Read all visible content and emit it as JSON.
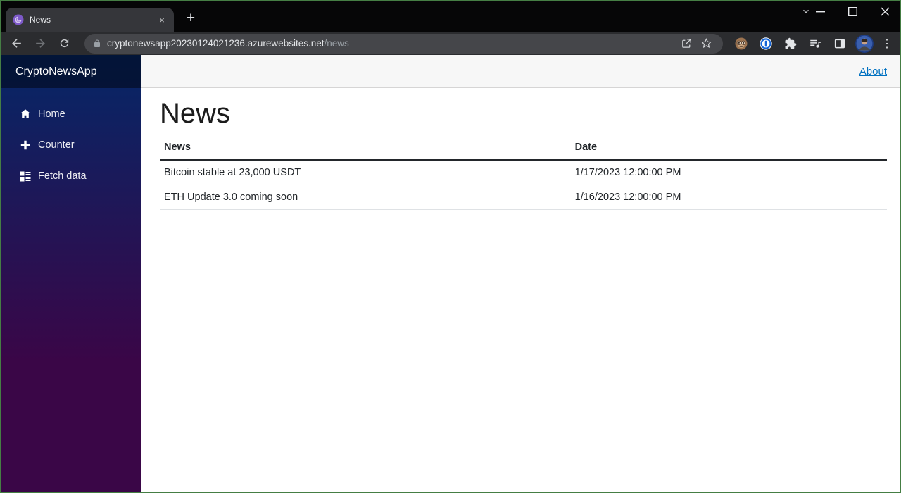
{
  "browser": {
    "tab_title": "News",
    "new_tab_glyph": "+",
    "tab_close_glyph": "×",
    "menu_dots_glyph": "⋮",
    "url": {
      "host": "cryptonewsapp20230124021236.azurewebsites.net",
      "path": "/news"
    },
    "toolbar_icons": [
      "back-icon",
      "forward-icon",
      "refresh-icon",
      "lock-icon",
      "share-icon",
      "bookmark-star-icon",
      "monkey-extension-icon",
      "onepassword-extension-icon",
      "puzzle-extensions-icon",
      "queue-music-extension-icon",
      "side-panel-icon",
      "profile-avatar",
      "kebab-menu-icon"
    ],
    "window_control_icons": [
      "chevron-down-icon",
      "minimize-icon",
      "maximize-icon",
      "close-icon"
    ]
  },
  "sidebar": {
    "brand": "CryptoNewsApp",
    "items": [
      {
        "label": "Home",
        "icon": "home-icon"
      },
      {
        "label": "Counter",
        "icon": "plus-icon"
      },
      {
        "label": "Fetch data",
        "icon": "list-rich-icon"
      }
    ]
  },
  "topbar": {
    "about": "About"
  },
  "page": {
    "title": "News",
    "table": {
      "headers": {
        "news": "News",
        "date": "Date"
      },
      "rows": [
        {
          "news": "Bitcoin stable at 23,000 USDT",
          "date": "1/17/2023 12:00:00 PM"
        },
        {
          "news": "ETH Update 3.0 coming soon",
          "date": "1/16/2023 12:00:00 PM"
        }
      ]
    }
  },
  "colors": {
    "sidebar_gradient_top": "#052767",
    "sidebar_gradient_bottom": "#3a0647",
    "link_blue": "#0071c1",
    "top_row_bg": "#f7f7f7",
    "chrome_titlebar": "#060607",
    "chrome_toolbar": "#2b2c2f",
    "tab_bg": "#35363a",
    "capture_frame_green": "#457e44"
  }
}
